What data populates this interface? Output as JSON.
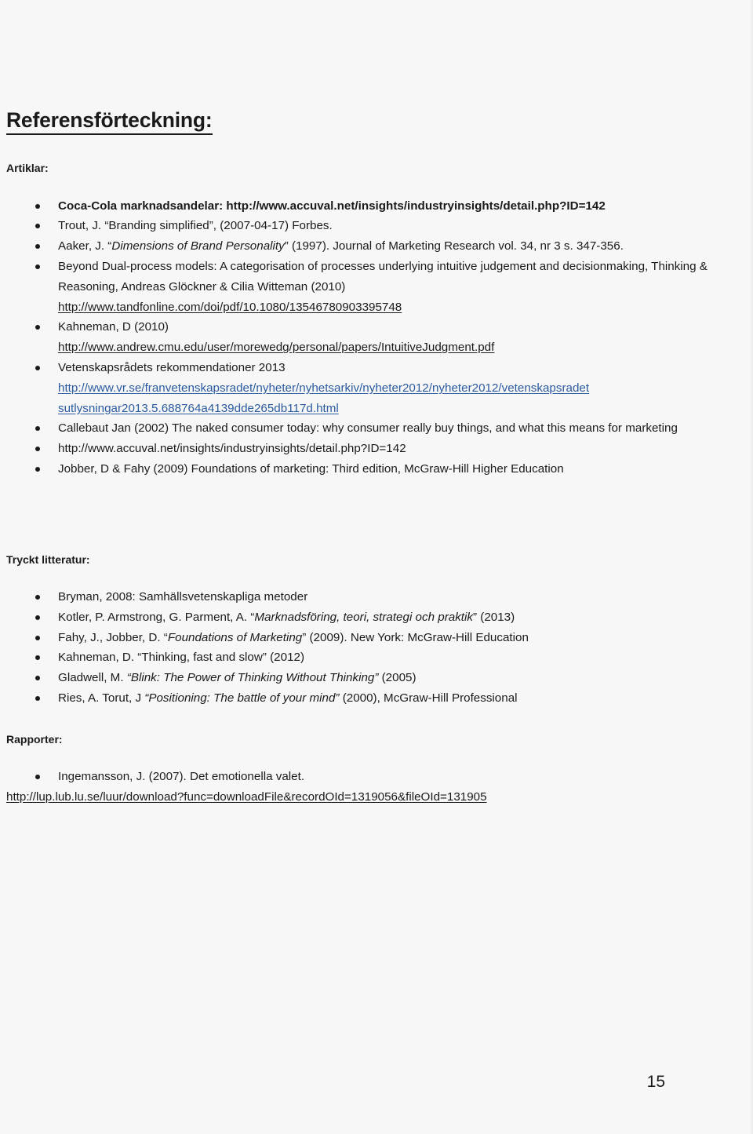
{
  "document": {
    "title": "Referensförteckning:",
    "page_number": "15"
  },
  "sections": {
    "articles": {
      "label": "Artiklar:",
      "items": {
        "coca_cola": {
          "prefix": "Coca-Cola marknadsandelar: ",
          "url": "http://www.accuval.net/insights/industryinsights/detail.php?ID=142"
        },
        "trout": "Trout, J. “Branding simplified”, (2007-04-17) Forbes.",
        "aaker": {
          "before": " Aaker, J. “",
          "italic": "Dimensions of Brand Personality",
          "after": "” (1997). Journal of Marketing Research vol. 34, nr 3 s. 347-356."
        },
        "glockner": {
          "line1": "Beyond Dual-process models: A categorisation of processes underlying intuitive judgement and",
          "line2": "decisionmaking, Thinking & Reasoning,  Andreas Glöckner & Cilia Witteman (2010)",
          "url": "http://www.tandfonline.com/doi/pdf/10.1080/13546780903395748"
        },
        "kahneman": {
          "line1": "Kahneman, D (2010)",
          "url": "http://www.andrew.cmu.edu/user/morewedg/personal/papers/IntuitiveJudgment.pdf"
        },
        "vetenskapsradet": {
          "line1": "Vetenskapsrådets rekommendationer 2013",
          "url_line1": "http://www.vr.se/franvetenskapsradet/nyheter/nyhetsarkiv/nyheter2012/nyheter2012/vetenskapsradet",
          "url_line2": "sutlysningar2013.5.688764a4139dde265db117d.html"
        },
        "callebaut": {
          "line1": "Callebaut Jan (2002) The naked consumer today: why consumer really buy things, and what this means for",
          "line2": "marketing"
        },
        "accuval_plain": "http://www.accuval.net/insights/industryinsights/detail.php?ID=142",
        "jobber": "Jobber, D & Fahy (2009) Foundations of marketing: Third edition, McGraw-Hill Higher Education"
      }
    },
    "printed": {
      "label": "Tryckt litteratur:",
      "items": {
        "bryman": "Bryman, 2008: Samhällsvetenskapliga metoder",
        "kotler": {
          "before": "Kotler, P. Armstrong, G. Parment, A. “",
          "italic": "Marknadsföring, teori, strategi och praktik",
          "after": "” (2013)"
        },
        "fahy": {
          "before": "Fahy, J., Jobber, D. “",
          "italic": "Foundations of Marketing",
          "after": "” (2009). New York: McGraw-Hill Education"
        },
        "kahneman": "Kahneman, D. “Thinking, fast and slow” (2012)",
        "gladwell": {
          "before": "Gladwell, M. ",
          "italic": "“Blink: The Power of Thinking Without Thinking”",
          "after": " (2005)"
        },
        "ries": {
          "before": "Ries, A. Torut, J ",
          "italic": "“Positioning: The battle of your mind”",
          "after": " (2000), McGraw-Hill Professional"
        }
      }
    },
    "reports": {
      "label": "Rapporter:",
      "items": {
        "ingemansson": "Ingemansson, J. (2007). Det emotionella valet.",
        "ingemansson_url": "http://lup.lub.lu.se/luur/download?func=downloadFile&recordOId=1319056&fileOId=131905"
      }
    }
  },
  "colors": {
    "text": "#1a1a1a",
    "link": "#2a5aa0",
    "background": "#f7f7f7"
  }
}
